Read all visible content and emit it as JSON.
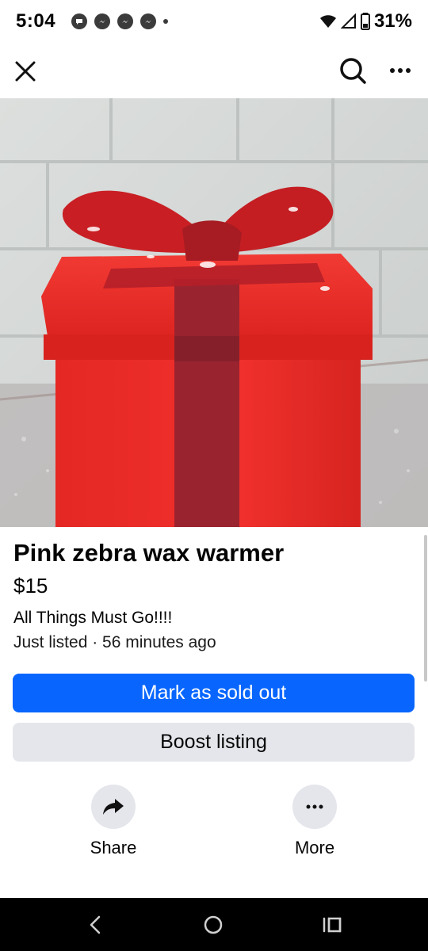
{
  "status_bar": {
    "time": "5:04",
    "battery": "31%",
    "notification_icons": [
      "chat-bubble-icon",
      "messenger-icon",
      "messenger-icon",
      "messenger-icon",
      "dot-icon"
    ],
    "icons": [
      "wifi-icon",
      "cellular-signal-icon",
      "battery-icon"
    ]
  },
  "top_bar": {
    "icons": [
      "close-icon",
      "search-icon",
      "more-horizontal-icon"
    ]
  },
  "listing": {
    "title": "Pink zebra wax warmer",
    "price": "$15",
    "description": "All Things Must Go!!!!",
    "meta": "Just listed · 56 minutes ago"
  },
  "buttons": {
    "mark_sold": "Mark as sold out",
    "boost": "Boost listing"
  },
  "actions": {
    "share": {
      "label": "Share",
      "icon": "share-arrow-icon"
    },
    "more": {
      "label": "More",
      "icon": "more-horizontal-icon"
    }
  },
  "nav_bar": {
    "icons": [
      "back-icon",
      "home-icon",
      "recents-icon"
    ]
  },
  "colors": {
    "primary": "#0866ff",
    "secondary_bg": "#e4e6eb",
    "text": "#050505",
    "nav_bg": "#000000"
  }
}
